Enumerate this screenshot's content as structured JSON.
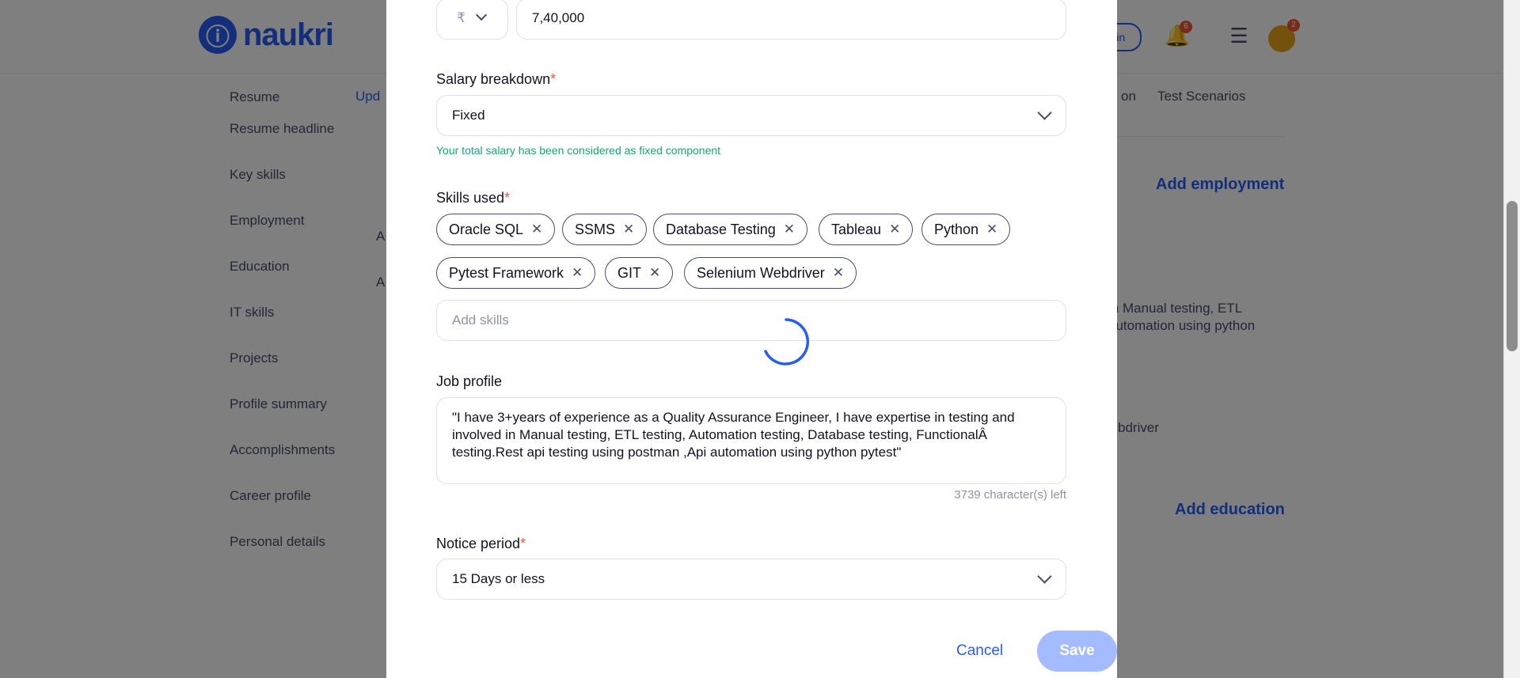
{
  "background": {
    "logo_text": "naukri",
    "header_pill": "Login",
    "notification_count": "6",
    "avatar_count": "2",
    "sidebar": [
      "Resume",
      "Resume headline",
      "Key skills",
      "Employment",
      "Education",
      "IT skills",
      "Projects",
      "Profile summary",
      "Accomplishments",
      "Career profile",
      "Personal details"
    ],
    "tab_left": "Upd",
    "tab_right_1": "on",
    "tab_right_2": "Test Scenarios",
    "add_employment": "Add employment",
    "add_education": "Add education",
    "frag_emp_a": "A",
    "frag_edu_a": "A",
    "employment_snippet": "in Manual testing, ETL\nautomation using python",
    "skills_snippet": "bdriver"
  },
  "modal": {
    "currency_symbol": "₹",
    "salary_value": "7,40,000",
    "salary_breakdown_label": "Salary breakdown",
    "salary_breakdown_value": "Fixed",
    "salary_hint": "Your total salary has been considered as fixed component",
    "skills_label": "Skills used",
    "skills": [
      "Oracle SQL",
      "SSMS",
      "Database Testing",
      "Tableau",
      "Python",
      "Pytest Framework",
      "GIT",
      "Selenium Webdriver"
    ],
    "add_skills_placeholder": "Add skills",
    "job_profile_label": "Job profile",
    "job_profile_text": "\"I have 3+years of experience as a Quality Assurance Engineer, I have expertise in testing and involved in Manual testing, ETL testing, Automation testing, Database testing, FunctionalÂ testing.Rest api testing using postman ,Api automation using python pytest\"",
    "chars_left": "3739 character(s) left",
    "notice_period_label": "Notice period",
    "notice_period_value": "15 Days or less",
    "cancel_label": "Cancel",
    "save_label": "Save",
    "required_mark": "*"
  },
  "colors": {
    "accent": "#275df5",
    "required": "#f05537",
    "hint_green": "#15a872",
    "save_disabled": "#a5bbff"
  }
}
